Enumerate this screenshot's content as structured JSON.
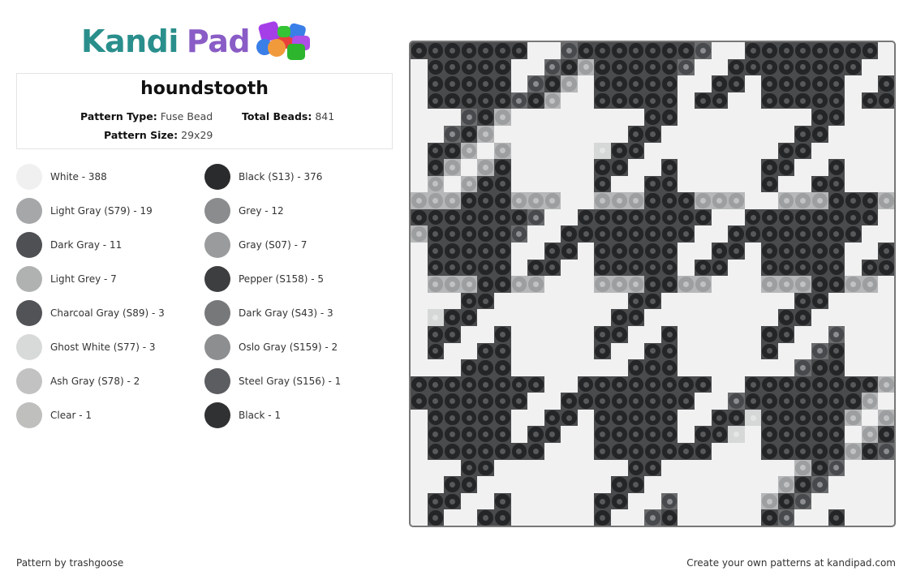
{
  "logo": {
    "part1": "Kandi",
    "part2": "Pad",
    "colors": {
      "kandi": "#2a8f8c",
      "pad": "#8a5cc6"
    }
  },
  "pattern": {
    "title": "houndstooth",
    "type_label": "Pattern Type:",
    "type_value": "Fuse Bead",
    "beads_label": "Total Beads:",
    "beads_value": "841",
    "size_label": "Pattern Size:",
    "size_value": "29x29"
  },
  "legend": [
    {
      "label": "White - 388",
      "color": "#f0f0f0"
    },
    {
      "label": "Black (S13) - 376",
      "color": "#2a2b2d"
    },
    {
      "label": "Light Gray (S79) - 19",
      "color": "#a5a7a9"
    },
    {
      "label": "Grey - 12",
      "color": "#8a8c8e"
    },
    {
      "label": "Dark Gray - 11",
      "color": "#4e5053"
    },
    {
      "label": "Gray (S07) - 7",
      "color": "#9a9b9d"
    },
    {
      "label": "Light Grey - 7",
      "color": "#b0b2b2"
    },
    {
      "label": "Pepper (S158) - 5",
      "color": "#3d3e40"
    },
    {
      "label": "Charcoal Gray (S89) - 3",
      "color": "#525356"
    },
    {
      "label": "Dark Gray (S43) - 3",
      "color": "#76787a"
    },
    {
      "label": "Ghost White (S77) - 3",
      "color": "#d8d9d9"
    },
    {
      "label": "Oslo Gray (S159) - 2",
      "color": "#8c8e90"
    },
    {
      "label": "Ash Gray (S78) - 2",
      "color": "#c2c2c2"
    },
    {
      "label": "Steel Gray (S156) - 1",
      "color": "#5c5d60"
    },
    {
      "label": "Clear - 1",
      "color": "#bfbfbe"
    },
    {
      "label": "Black - 1",
      "color": "#303133"
    }
  ],
  "grid": {
    "size": 29,
    "legend_codes": {
      "W": "White",
      "B": "Black",
      "d": "Dark Gray",
      "g": "Light Gray",
      "p": "Ghost White"
    },
    "rows": [
      "BBBBBBBWWdBBBBBBBdWWBBBBBBBBW",
      "WBBBBBWWdBgBBBBBdWWBBBBBBBBWW",
      "WBBBBBWdBgWBBBBBWWBBWBBBBBWWB",
      "WBBBBBdBgWWBBBBBWBBWWBBBBBWBB",
      "WWWdBgWWWWWWWWBBWWWWWWWWBBWWW",
      "WWdBgWWWWWWWWBBWWWWWWWWBBWWWW",
      "WBBgWgWWWWWpBBWWWWWWWWBBWWWWW",
      "WBgWgBWWWWWBBWWBWWWWWBBWWBWWW",
      "WgWgBBWWWWWBWWBBWWWWWBWWBBWWW",
      "gggBBBgggWWgggBBBgggWWgggBBBggg",
      "BBBBBBBdWWBBBBBBBBWWBBBBBBBBW",
      "gBBBBBdWWBBBBBBBBWWBBBBBBBBWW",
      "WBBBBBWWBBWBBBBBWWBBWBBBBBWWB",
      "WBBBBBWBBWWBBBBBWBBWWBBBBBWBB",
      "WgggBBggWWWgggBBggWWWgggBBggW",
      "WWWBBWWWWWWWWBBWWWWWWWWBBWWWW",
      "WpBBWWWWWWWWBBWWWWWWWWBBWWWWW",
      "WBBWWBWWWWWBBWWBWWWWWBBWWdWWW",
      "WBWWBBWWWWWBWWBBWWWWWBWWdBWWW",
      "WWWBBBWWWWWWWBBBWWWWWWWdBBWWW",
      "BBBBBBBBWWBBBBBBBBWWBBBBBBBBg",
      "BBBBBBBWWBBBBBBBBWWdBBBBBBBgW",
      "WBBBBBWWBBWBBBBBWWBBpBBBBBgWg",
      "WBBBBBWBBWWBBBBBWBBpWBBBBBWgB",
      "WBBBBBBBWWWBBBBBBBWWWBBBBBgBd",
      "WWWBBWWWWWWWWBBWWWWWWWWgBdWWW",
      "WWBBWWWWWWWWBBWWWWWWWWgBdWWWW",
      "WBBWWBWWWWWBBWWdWWWWWgBdWWWWW",
      "WBWWBBWWWWWBWWdBWWWWWBdWWBWWW"
    ]
  },
  "footer": {
    "credit": "Pattern by trashgoose",
    "promo": "Create your own patterns at kandipad.com"
  }
}
